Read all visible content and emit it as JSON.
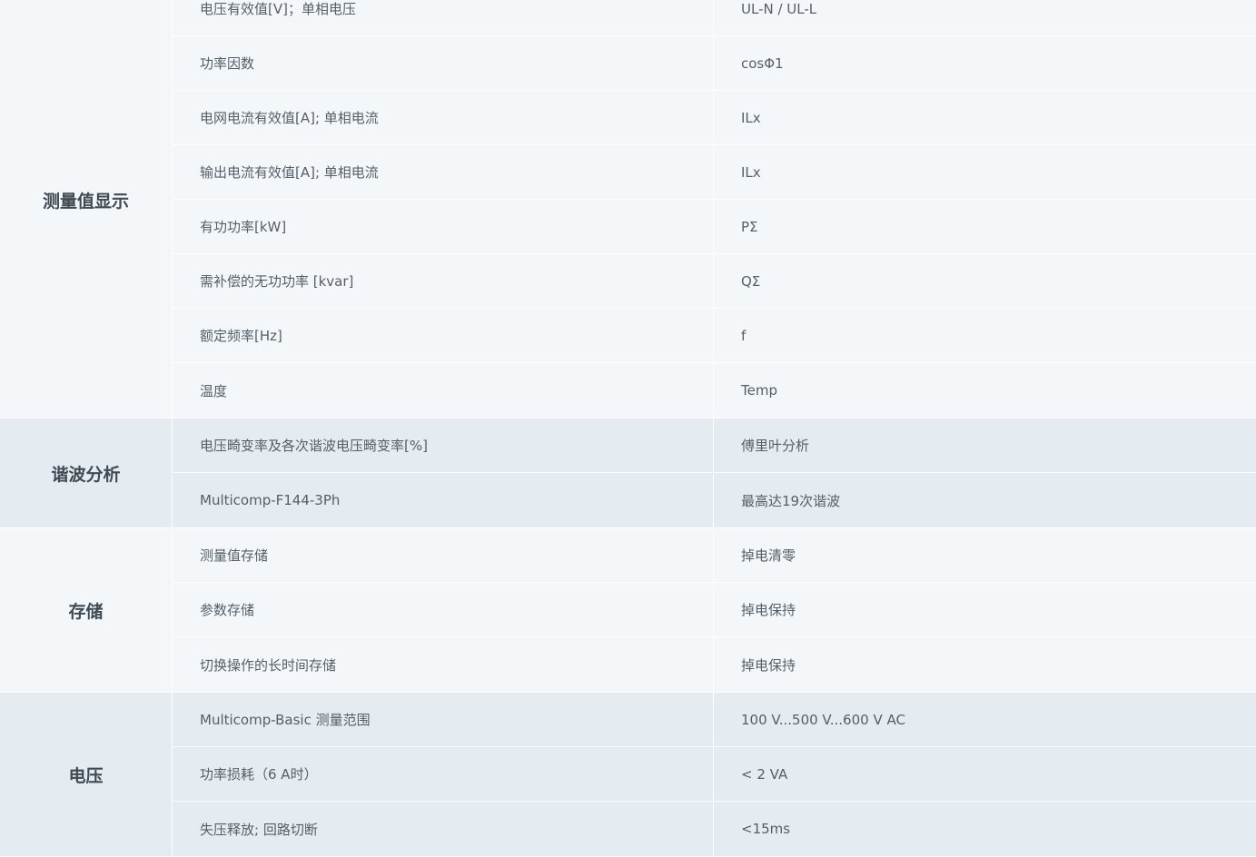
{
  "groups": [
    {
      "category": "测量值显示",
      "rows": [
        {
          "param": "电压有效值[V]；单相电压",
          "value": "UL-N / UL-L"
        },
        {
          "param": "功率因数",
          "value": "cosΦ1"
        },
        {
          "param": "电网电流有效值[A]; 单相电流",
          "value": "ILx"
        },
        {
          "param": "输出电流有效值[A]; 单相电流",
          "value": "ILx"
        },
        {
          "param": "有功功率[kW]",
          "value": "PΣ"
        },
        {
          "param": "需补偿的无功功率 [kvar]",
          "value": "QΣ"
        },
        {
          "param": "额定频率[Hz]",
          "value": "f"
        },
        {
          "param": "温度",
          "value": "Temp"
        }
      ]
    },
    {
      "category": "谐波分析",
      "rows": [
        {
          "param": "电压畸变率及各次谐波电压畸变率[%]",
          "value": "傅里叶分析"
        },
        {
          "param": "Multicomp-F144-3Ph",
          "value": "最高达19次谐波"
        }
      ]
    },
    {
      "category": "存储",
      "rows": [
        {
          "param": "测量值存储",
          "value": "掉电清零"
        },
        {
          "param": "参数存储",
          "value": "掉电保持"
        },
        {
          "param": "切换操作的长时间存储",
          "value": "掉电保持"
        }
      ]
    },
    {
      "category": "电压",
      "rows": [
        {
          "param": "Multicomp-Basic 测量范围",
          "value": "100 V...500 V...600 V AC"
        },
        {
          "param": "功率损耗（6 A时）",
          "value": "< 2 VA"
        },
        {
          "param": "失压释放; 回路切断",
          "value": "<15ms"
        }
      ]
    }
  ]
}
